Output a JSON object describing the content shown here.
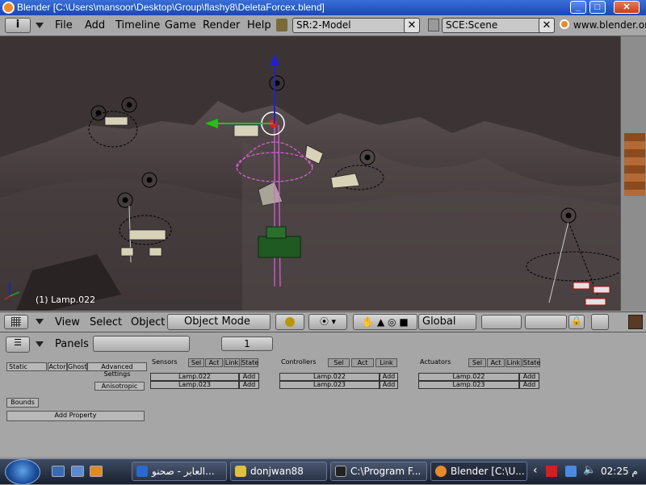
{
  "window": {
    "title": "Blender [C:\\Users\\mansoor\\Desktop\\Group\\flashy8\\DeletaForcex.blend]"
  },
  "menubar": {
    "info_label": "i",
    "menus": [
      "File",
      "Add",
      "Timeline",
      "Game",
      "Render",
      "Help"
    ],
    "screen_field": "SR:2-Model",
    "scene_field": "SCE:Scene",
    "url": "www.blender.org"
  },
  "viewport": {
    "object_label": "(1) Lamp.022"
  },
  "viewport_toolbar": {
    "menus": [
      "View",
      "Select",
      "Object"
    ],
    "mode": "Object Mode",
    "orientation": "Global"
  },
  "buttons_header": {
    "panels_label": "Panels",
    "frame_value": "1"
  },
  "logic": {
    "physics_type": "Static",
    "actor_label": "Actor",
    "ghost_label": "Ghost",
    "advanced_label": "Advanced Settings",
    "anisotropic_label": "Anisotropic",
    "bounds_label": "Bounds",
    "add_property_label": "Add Property",
    "sensors": {
      "title": "Sensors",
      "tabs": [
        "Sel",
        "Act",
        "Link",
        "State"
      ],
      "rows": [
        "Lamp.022",
        "Lamp.023"
      ],
      "add_label": "Add"
    },
    "controllers": {
      "title": "Controllers",
      "tabs": [
        "Sel",
        "Act",
        "Link"
      ],
      "rows": [
        "Lamp.022",
        "Lamp.023"
      ],
      "add_label": "Add"
    },
    "actuators": {
      "title": "Actuators",
      "tabs": [
        "Sel",
        "Act",
        "Link",
        "State"
      ],
      "rows": [
        "Lamp.022",
        "Lamp.023"
      ],
      "add_label": "Add"
    }
  },
  "taskbar": {
    "tasks": [
      "العابر - صحنو...",
      "donjwan88",
      "C:\\Program F...",
      "Blender [C:\\U..."
    ],
    "clock": "02:25 م"
  }
}
